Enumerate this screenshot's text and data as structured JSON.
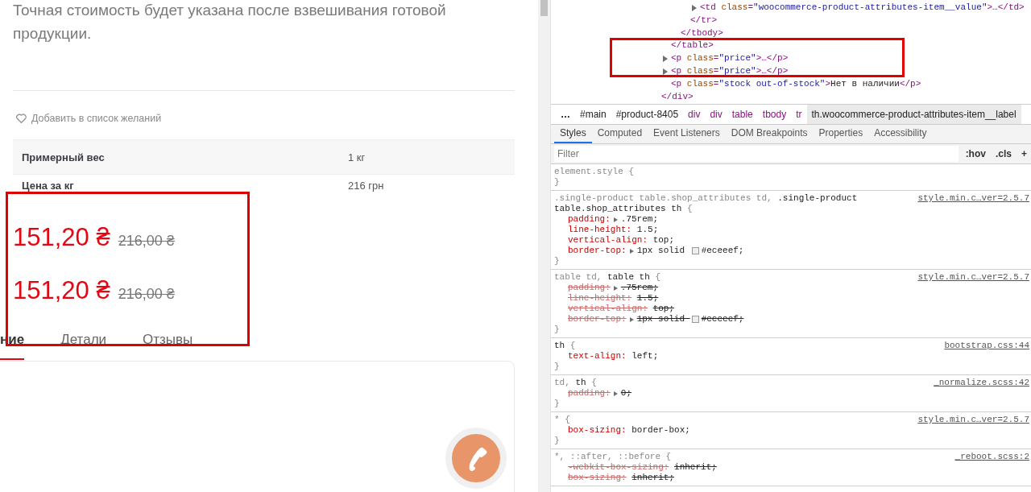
{
  "product": {
    "description": "Точная стоимость будет указана после взвешивания готовой продукции.",
    "wishlist_link": "Добавить в список желаний",
    "attributes": [
      {
        "label": "Примерный вес",
        "value": "1 кг"
      },
      {
        "label": "Цена за кг",
        "value": "216 грн"
      }
    ],
    "prices": [
      {
        "current": "151,20 ₴",
        "regular": "216,00 ₴"
      },
      {
        "current": "151,20 ₴",
        "regular": "216,00 ₴"
      }
    ],
    "tabs": [
      {
        "label": "ние",
        "selected": true
      },
      {
        "label": "Детали",
        "selected": false
      },
      {
        "label": "Отзывы",
        "selected": false
      }
    ]
  },
  "devtools": {
    "dom_tree": [
      {
        "children": [
          {
            "children": [
              {
                "children": [
                  {
                    "children": [
                      {
                        "expandable": true,
                        "parts": [
                          {
                            "kind": "tag",
                            "text": "<td "
                          },
                          {
                            "kind": "attr",
                            "text": "class"
                          },
                          {
                            "kind": "tag",
                            "text": "="
                          },
                          {
                            "kind": "value",
                            "text": "\"woocommerce-product-attributes-item__value\""
                          },
                          {
                            "kind": "tag",
                            "text": ">…</td>"
                          }
                        ]
                      }
                    ],
                    "closing": [
                      {
                        "kind": "tag",
                        "text": "</tr>"
                      }
                    ]
                  }
                ],
                "closing": [
                  {
                    "kind": "tag",
                    "text": "</tbody>"
                  }
                ]
              }
            ],
            "closing": [
              {
                "kind": "tag",
                "text": "</table>"
              }
            ]
          },
          {
            "expandable": true,
            "parts": [
              {
                "kind": "tag",
                "text": "<p "
              },
              {
                "kind": "attr",
                "text": "class"
              },
              {
                "kind": "tag",
                "text": "="
              },
              {
                "kind": "value",
                "text": "\"price\""
              },
              {
                "kind": "tag",
                "text": ">…</p>"
              }
            ]
          },
          {
            "expandable": true,
            "parts": [
              {
                "kind": "tag",
                "text": "<p "
              },
              {
                "kind": "attr",
                "text": "class"
              },
              {
                "kind": "tag",
                "text": "="
              },
              {
                "kind": "value",
                "text": "\"price\""
              },
              {
                "kind": "tag",
                "text": ">…</p>"
              }
            ]
          },
          {
            "expandable": false,
            "parts": [
              {
                "kind": "tag",
                "text": "<p "
              },
              {
                "kind": "attr",
                "text": "class"
              },
              {
                "kind": "tag",
                "text": "="
              },
              {
                "kind": "value",
                "text": "\"stock out-of-stock\""
              },
              {
                "kind": "tag",
                "text": ">"
              },
              {
                "kind": "text",
                "text": "Нет в наличии"
              },
              {
                "kind": "tag",
                "text": "</p>"
              }
            ]
          }
        ],
        "closing": [
          {
            "kind": "tag",
            "text": "</div>"
          }
        ]
      }
    ],
    "breadcrumbs": [
      {
        "text": "…",
        "kind": "more",
        "selected": false
      },
      {
        "text": "#main",
        "kind": "id",
        "selected": false
      },
      {
        "text": "#product-8405",
        "kind": "id",
        "selected": false
      },
      {
        "text": "div",
        "kind": "tag",
        "selected": false
      },
      {
        "text": "div",
        "kind": "tag",
        "selected": false
      },
      {
        "text": "table",
        "kind": "tag",
        "selected": false
      },
      {
        "text": "tbody",
        "kind": "tag",
        "selected": false
      },
      {
        "text": "tr",
        "kind": "tag",
        "selected": false
      },
      {
        "text": "th.woocommerce-product-attributes-item__label",
        "kind": "tag",
        "selected": true
      }
    ],
    "tabs": [
      {
        "label": "Styles",
        "selected": true
      },
      {
        "label": "Computed",
        "selected": false
      },
      {
        "label": "Event Listeners",
        "selected": false
      },
      {
        "label": "DOM Breakpoints",
        "selected": false
      },
      {
        "label": "Properties",
        "selected": false
      },
      {
        "label": "Accessibility",
        "selected": false
      }
    ],
    "filter": {
      "placeholder": "Filter"
    },
    "filter_buttons": [
      ":hov",
      ".cls",
      "+"
    ],
    "rules": [
      {
        "selector": [
          {
            "text": "element.style {",
            "matched": false
          }
        ],
        "close": "}"
      },
      {
        "selector": [
          {
            "text": ".single-product table.shop_attributes td, ",
            "matched": false
          },
          {
            "text": ".single-product table.shop_attributes th",
            "matched": true
          },
          {
            "text": " {",
            "matched": false
          }
        ],
        "source": "style.min.c…ver=2.5.7",
        "properties": [
          {
            "name": "padding:",
            "value": ".75rem;",
            "expandable": true,
            "overridden": false
          },
          {
            "name": "line-height:",
            "value": "1.5;",
            "expandable": false,
            "overridden": false
          },
          {
            "name": "vertical-align:",
            "value": "top;",
            "expandable": false,
            "overridden": false
          },
          {
            "name": "border-top:",
            "value": "1px solid ",
            "color": "#eceeef",
            "value_after": "#eceeef;",
            "expandable": true,
            "overridden": false
          }
        ],
        "close": "}"
      },
      {
        "selector": [
          {
            "text": "table td, ",
            "matched": false
          },
          {
            "text": "table th",
            "matched": true
          },
          {
            "text": " {",
            "matched": false
          }
        ],
        "source": "style.min.c…ver=2.5.7",
        "properties": [
          {
            "name": "padding:",
            "value": ".75rem;",
            "expandable": true,
            "overridden": true
          },
          {
            "name": "line-height:",
            "value": "1.5;",
            "expandable": false,
            "overridden": true
          },
          {
            "name": "vertical-align:",
            "value": "top;",
            "expandable": false,
            "overridden": true
          },
          {
            "name": "border-top:",
            "value": "1px solid ",
            "color": "#eceeef",
            "value_after": "#eceeef;",
            "expandable": true,
            "overridden": true
          }
        ],
        "close": "}"
      },
      {
        "selector": [
          {
            "text": "th",
            "matched": true
          },
          {
            "text": " {",
            "matched": false
          }
        ],
        "source": "bootstrap.css:44",
        "properties": [
          {
            "name": "text-align:",
            "value": "left;",
            "expandable": false,
            "overridden": false
          }
        ],
        "close": "}"
      },
      {
        "selector": [
          {
            "text": "td, ",
            "matched": false
          },
          {
            "text": "th",
            "matched": true
          },
          {
            "text": " {",
            "matched": false
          }
        ],
        "source": "_normalize.scss:42",
        "properties": [
          {
            "name": "padding:",
            "value": "0;",
            "expandable": true,
            "overridden": true
          }
        ],
        "close": "}"
      },
      {
        "selector": [
          {
            "text": "*",
            "matched": false
          },
          {
            "text": " {",
            "matched": false
          }
        ],
        "source": "style.min.c…ver=2.5.7",
        "properties": [
          {
            "name": "box-sizing:",
            "value": "border-box;",
            "expandable": false,
            "overridden": false
          }
        ],
        "close": "}"
      },
      {
        "selector": [
          {
            "text": "*, ::after, ::before {",
            "matched": false
          }
        ],
        "source": "_reboot.scss:2",
        "properties": [
          {
            "name": "-webkit-box-sizing:",
            "value": "inherit;",
            "expandable": false,
            "overridden": true
          },
          {
            "name": "box-sizing:",
            "value": "inherit;",
            "expandable": false,
            "overridden": true
          }
        ]
      }
    ]
  }
}
